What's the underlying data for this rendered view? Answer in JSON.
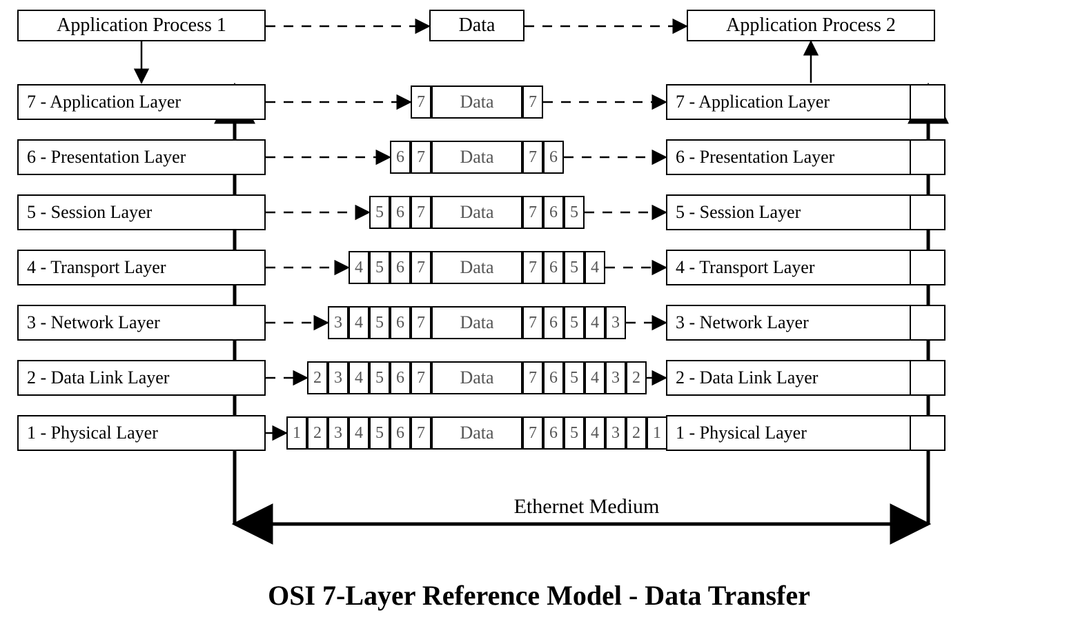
{
  "title": "OSI 7-Layer Reference Model - Data Transfer",
  "ethernet_label": "Ethernet Medium",
  "top": {
    "process1": "Application Process 1",
    "data": "Data",
    "process2": "Application Process 2"
  },
  "layers": [
    {
      "num": "7",
      "name": "Application Layer",
      "label": "7 - Application Layer",
      "data": "Data",
      "headers": [
        "7"
      ],
      "trailers": [
        "7"
      ]
    },
    {
      "num": "6",
      "name": "Presentation Layer",
      "label": "6 - Presentation Layer",
      "data": "Data",
      "headers": [
        "6",
        "7"
      ],
      "trailers": [
        "7",
        "6"
      ]
    },
    {
      "num": "5",
      "name": "Session Layer",
      "label": "5 - Session Layer",
      "data": "Data",
      "headers": [
        "5",
        "6",
        "7"
      ],
      "trailers": [
        "7",
        "6",
        "5"
      ]
    },
    {
      "num": "4",
      "name": "Transport Layer",
      "label": "4 - Transport Layer",
      "data": "Data",
      "headers": [
        "4",
        "5",
        "6",
        "7"
      ],
      "trailers": [
        "7",
        "6",
        "5",
        "4"
      ]
    },
    {
      "num": "3",
      "name": "Network Layer",
      "label": "3 - Network Layer",
      "data": "Data",
      "headers": [
        "3",
        "4",
        "5",
        "6",
        "7"
      ],
      "trailers": [
        "7",
        "6",
        "5",
        "4",
        "3"
      ]
    },
    {
      "num": "2",
      "name": "Data Link Layer",
      "label": "2 - Data Link Layer",
      "data": "Data",
      "headers": [
        "2",
        "3",
        "4",
        "5",
        "6",
        "7"
      ],
      "trailers": [
        "7",
        "6",
        "5",
        "4",
        "3",
        "2"
      ]
    },
    {
      "num": "1",
      "name": "Physical Layer",
      "label": "1 - Physical Layer",
      "data": "Data",
      "headers": [
        "1",
        "2",
        "3",
        "4",
        "5",
        "6",
        "7"
      ],
      "trailers": [
        "7",
        "6",
        "5",
        "4",
        "3",
        "2",
        "1"
      ]
    }
  ]
}
